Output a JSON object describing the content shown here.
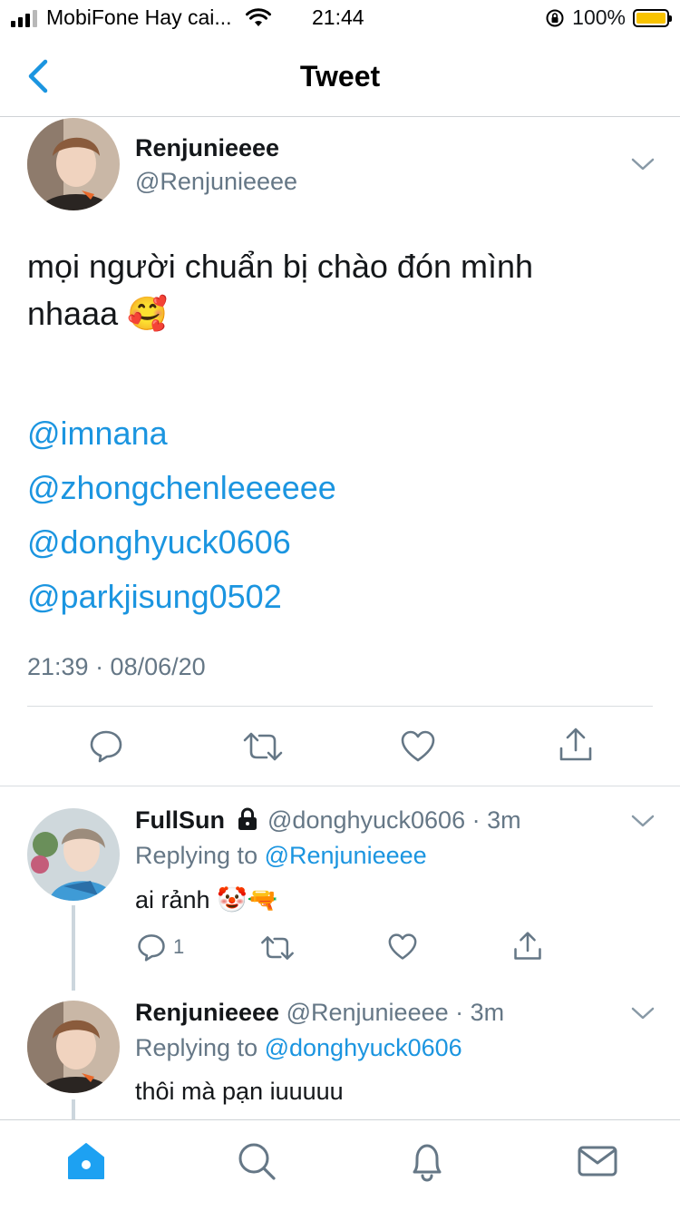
{
  "status_bar": {
    "carrier": "MobiFone Hay cai...",
    "time": "21:44",
    "battery": "100%"
  },
  "header": {
    "title": "Tweet"
  },
  "tweet": {
    "author_name": "Renjunieeee",
    "author_handle": "@Renjunieeee",
    "text_line1": "mọi người chuẩn bị chào đón mình",
    "text_line2": "nhaaa",
    "emoji": "🥰",
    "mentions": [
      "@imnana",
      "@zhongchenleeeeee",
      "@donghyuck0606",
      "@parkjisung0502"
    ],
    "timestamp": "21:39 · 08/06/20"
  },
  "replies": [
    {
      "name": "FullSun",
      "handle": "@donghyuck0606",
      "time": "3m",
      "locked": true,
      "replying_prefix": "Replying to ",
      "replying_to": "@Renjunieeee",
      "text": "ai rảnh",
      "emojis": "🤡🔫",
      "reply_count": "1"
    },
    {
      "name": "Renjunieeee",
      "handle": "@Renjunieeee",
      "time": "3m",
      "replying_prefix": "Replying to ",
      "replying_to": "@donghyuck0606",
      "text": "thôi mà pạn iuuuuu"
    }
  ],
  "colors": {
    "accent": "#1b95e0",
    "muted": "#657786",
    "text": "#14171a"
  },
  "tabs": [
    "home-icon",
    "search-icon",
    "notifications-icon",
    "messages-icon"
  ]
}
